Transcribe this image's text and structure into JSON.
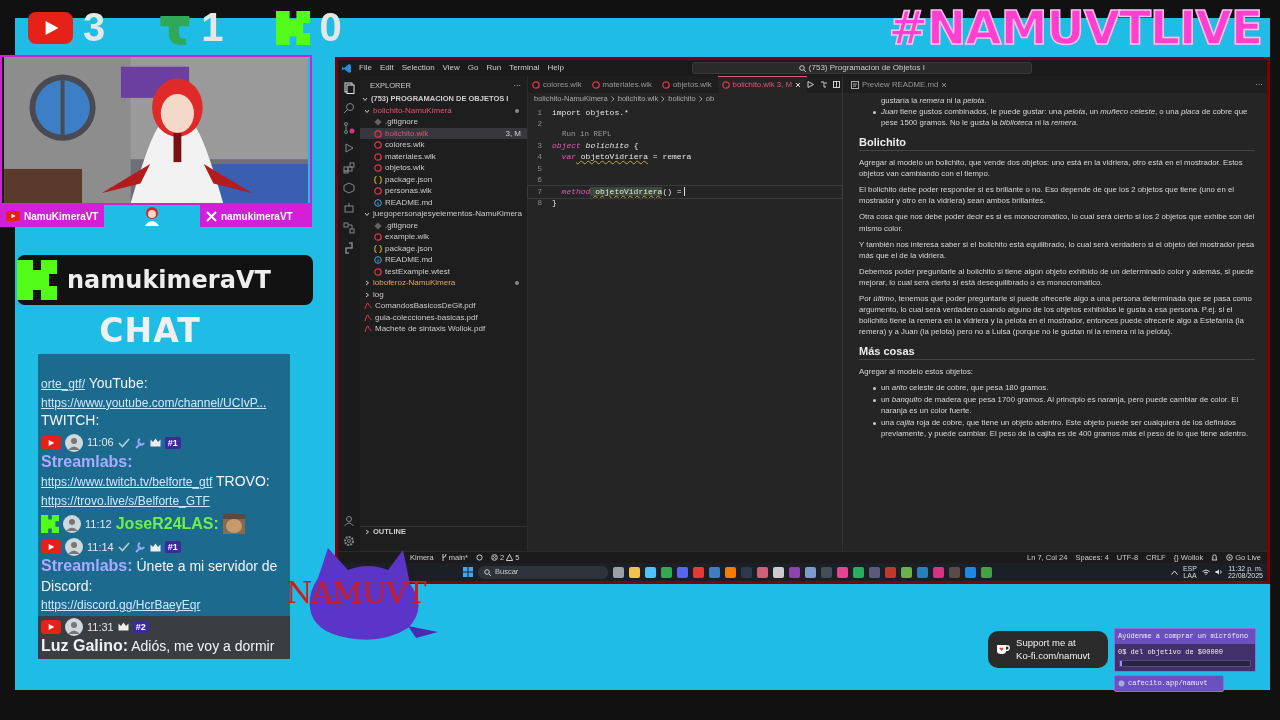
{
  "counters": [
    {
      "kind": "youtube",
      "count": "3"
    },
    {
      "kind": "trovo",
      "count": "1"
    },
    {
      "kind": "kick",
      "count": "0"
    }
  ],
  "hashtag": "#NAMUVTLIVE",
  "avatar_scene": {
    "kind": "picture"
  },
  "socials": {
    "left": {
      "kind": "youtube",
      "handle": "NamuKimeraVT"
    },
    "right": {
      "kind": "x",
      "handle": "namukimeraVT"
    }
  },
  "kick_channel": "namukimeraVT",
  "chat_title": "CHAT",
  "chat": [
    {
      "parts": [
        {
          "kind": "link",
          "text": "orte_gtf/"
        },
        {
          "kind": "text",
          "text": " YouTube:"
        },
        {
          "kind": "link",
          "text": "https://www.youtube.com/channel/UCIvP..."
        },
        {
          "kind": "text",
          "text": " TWITCH:"
        }
      ]
    },
    {
      "header": {
        "kind": "youtube",
        "time": "11:06",
        "verified": true,
        "badge": "#1"
      },
      "user": {
        "name": "Streamlabs:",
        "color": "#a9abff"
      },
      "parts": [
        {
          "kind": "link",
          "text": "https://www.twitch.tv/belforte_gtf"
        },
        {
          "kind": "text",
          "text": " TROVO:"
        },
        {
          "kind": "link",
          "text": "https://trovo.live/s/Belforte_GTF"
        }
      ]
    },
    {
      "header": {
        "kind": "kick",
        "time": "11:12",
        "verified": false
      },
      "user": {
        "name": "JoseR24LAS:",
        "color": "#6ef04a"
      },
      "emote": true
    },
    {
      "header": {
        "kind": "youtube",
        "time": "11:14",
        "verified": true,
        "badge": "#1"
      },
      "user": {
        "name": "Streamlabs:",
        "color": "#a9abff"
      },
      "parts": [
        {
          "kind": "text",
          "text": " Únete a mi servidor de Discord:"
        },
        {
          "kind": "link",
          "text": "https://discord.gg/HcrBaeyEqr"
        }
      ]
    },
    {
      "header": {
        "kind": "youtube",
        "time": "11:31",
        "verified": false,
        "badge": "#2"
      },
      "user": {
        "name": "Luz Galino:",
        "color": "#f2f2f2"
      },
      "parts": [
        {
          "kind": "text",
          "text": " Adiós, me voy a dormir"
        }
      ]
    }
  ],
  "logo_text": "NAMUVT",
  "vscode": {
    "menu": [
      "File",
      "Edit",
      "Selection",
      "View",
      "Go",
      "Run",
      "Terminal",
      "Help"
    ],
    "command_center": "(753) Programacion de Objetos I",
    "activity": [
      {
        "kind": "files",
        "selected": true
      },
      {
        "kind": "search",
        "selected": false
      },
      {
        "kind": "branch",
        "selected": false
      },
      {
        "kind": "run",
        "selected": false
      },
      {
        "kind": "blocks",
        "selected": false
      },
      {
        "kind": "cube",
        "selected": false
      },
      {
        "kind": "robot",
        "selected": false
      },
      {
        "kind": "nodes",
        "selected": false
      },
      {
        "kind": "logo",
        "selected": false
      }
    ],
    "explorer": {
      "title": "EXPLORER",
      "more": "···",
      "root": "(753) PROGRAMACION DE OBJETOS I",
      "outline": "OUTLINE",
      "tree": [
        {
          "label": "bolichito-NamuKimera",
          "kind": "folder",
          "expanded": true,
          "problems": true,
          "modified": true,
          "selected": false,
          "children": [
            {
              "label": ".gitignore",
              "kind": "git",
              "problems": false,
              "modified": false,
              "selected": false
            },
            {
              "label": "bolichito.wlk",
              "kind": "wollok",
              "problems": true,
              "modified": false,
              "badge": "3, M",
              "selected": true
            },
            {
              "label": "colores.wlk",
              "kind": "wollok",
              "problems": false,
              "modified": false,
              "selected": false
            },
            {
              "label": "materiales.wlk",
              "kind": "wollok",
              "problems": false,
              "modified": false,
              "selected": false
            },
            {
              "label": "objetos.wlk",
              "kind": "wollok",
              "problems": false,
              "modified": false,
              "selected": false
            },
            {
              "label": "package.json",
              "kind": "json",
              "problems": false,
              "modified": false,
              "selected": false
            },
            {
              "label": "personas.wlk",
              "kind": "wollok",
              "problems": false,
              "modified": false,
              "selected": false
            },
            {
              "label": "README.md",
              "kind": "info",
              "problems": false,
              "modified": false,
              "selected": false
            }
          ]
        },
        {
          "label": "juegopersonajesyelementos-NamuKimera",
          "kind": "folder",
          "expanded": true,
          "problems": false,
          "modified": false,
          "selected": false,
          "children": [
            {
              "label": ".gitignore",
              "kind": "git",
              "problems": false,
              "modified": false,
              "selected": false
            },
            {
              "label": "example.wlk",
              "kind": "wollok",
              "problems": false,
              "modified": false,
              "selected": false
            },
            {
              "label": "package.json",
              "kind": "json",
              "problems": false,
              "modified": false,
              "selected": false
            },
            {
              "label": "README.md",
              "kind": "info",
              "problems": false,
              "modified": false,
              "selected": false
            },
            {
              "label": "testExample.wtest",
              "kind": "wollok",
              "problems": false,
              "modified": false,
              "selected": false
            }
          ]
        },
        {
          "label": "loboferoz-NamuKimera",
          "kind": "folder",
          "expanded": false,
          "problems": false,
          "modified": true,
          "selected": false
        },
        {
          "label": "log",
          "kind": "folder",
          "expanded": false,
          "problems": false,
          "modified": false,
          "selected": false
        },
        {
          "label": "ComandosBasicosDeGit.pdf",
          "kind": "pdf",
          "problems": false,
          "modified": false,
          "selected": false
        },
        {
          "label": "guia-colecciones-basicas.pdf",
          "kind": "pdf",
          "problems": false,
          "modified": false,
          "selected": false
        },
        {
          "label": "Machete de sintaxis Wollok.pdf",
          "kind": "pdf",
          "problems": false,
          "modified": false,
          "selected": false
        }
      ]
    },
    "tabs": [
      {
        "label": "colores.wlk",
        "selected": false
      },
      {
        "label": "materiales.wlk",
        "selected": false
      },
      {
        "label": "objetos.wlk",
        "selected": false
      },
      {
        "label": "bolichito.wlk",
        "badge": "3, M",
        "selected": true
      }
    ],
    "breadcrumbs": [
      "bolichito-NamuKimera",
      "bolichito.wlk",
      "bolichito",
      "ob"
    ],
    "code": [
      {
        "kind": "line",
        "num": "1",
        "current": false,
        "tokens": [
          {
            "kind": "plain",
            "text": "import objetos.*"
          }
        ]
      },
      {
        "kind": "line",
        "num": "2",
        "current": false
      },
      {
        "kind": "codelens",
        "text": "Run in REPL"
      },
      {
        "kind": "line",
        "num": "3",
        "current": false,
        "tokens": [
          {
            "kind": "keyword",
            "text": "object"
          },
          {
            "kind": "name",
            "text": " bolichito"
          },
          {
            "kind": "plain",
            "text": " {"
          }
        ]
      },
      {
        "kind": "line",
        "num": "4",
        "current": false,
        "tokens": [
          {
            "kind": "keyword",
            "text": "  var"
          },
          {
            "kind": "warning",
            "text": " objetoVidriera"
          },
          {
            "kind": "plain",
            "text": " = remera"
          }
        ]
      },
      {
        "kind": "line",
        "num": "5",
        "current": false
      },
      {
        "kind": "line",
        "num": "6",
        "current": false
      },
      {
        "kind": "line",
        "num": "7",
        "current": true,
        "tokens": [
          {
            "kind": "keyword",
            "text": "  method"
          },
          {
            "kind": "match",
            "text": " objetoVidriera"
          },
          {
            "kind": "plain",
            "text": "() ="
          }
        ]
      },
      {
        "kind": "line",
        "num": "8",
        "current": false,
        "tokens": [
          {
            "kind": "plain",
            "text": "}"
          }
        ]
      }
    ],
    "preview": {
      "tab": "Preview README.md",
      "blocks": [
        {
          "kind": "cont",
          "text": "gustaría la *remera* ni la *pelota*."
        },
        {
          "kind": "bullet",
          "text": "*Juan* tiene gustos combinados, le puede gustar: una *pelota*, un *muñeco celeste*, o una *placa* de cobre que pese 1500 gramos. No le gusta la *biblioteca* ni la *remera*."
        },
        {
          "kind": "heading",
          "text": "Bolichito"
        },
        {
          "kind": "para",
          "text": "Agregar al modelo un bolichito, que vende dos objetos: uno está en la vidriera, otro está en el mostrador. Estos objetos van cambiando con el tiempo."
        },
        {
          "kind": "para",
          "text": "El bolichito debe poder responder si es brillante o no. Eso depende de que los 2 objetos que tiene (uno en el mostrador y otro en la vidriera) sean ambos brillantes."
        },
        {
          "kind": "para",
          "text": "Otra cosa que nos debe poder decir es si es monocromático, lo cual será cierto si los 2 objetos que exhibe son del mismo color."
        },
        {
          "kind": "para",
          "text": "Y también nos interesa saber si el bolichito está equilibrado, lo cual será verdadero si el objeto del mostrador pesa más que el de la vidriera."
        },
        {
          "kind": "para",
          "text": "Debemos poder preguntarle al bolichito si tiene algún objeto exhibido de un determinado color y además, si puede mejorar, lo cual será cierto si está desequilibrado o es monocromático."
        },
        {
          "kind": "para",
          "text": "Por *último*, tenemos que poder preguntarle si puede ofrecerle algo a una persona determinada que se pasa como argumento, lo cual será verdadero cuando alguno de los objetos exhibidos le gusta a esa persona. P.ej. si el bolichito tiene la remera en la vidriera y la pelota en el mostrador, entonces puede ofrecerle algo a Estefanía (la remera) y a Juan (la pelota) pero no a Luisa (porque no le gustan ni la remera ni la pelota)."
        },
        {
          "kind": "heading",
          "text": "Más cosas"
        },
        {
          "kind": "para",
          "text": "Agregar al modelo estos objetos:"
        },
        {
          "kind": "bullet",
          "text": "un *arito* celeste de cobre, que pesa 180 gramos."
        },
        {
          "kind": "bullet",
          "text": "un *banquito* de madera que pesa 1700 gramos. Al principio es naranja, pero puede cambiar de color. El naranja es un color fuerte."
        },
        {
          "kind": "bullet",
          "text": "una *cajita* roja de cobre, que tiene un objeto adentro. Este objeto puede ser cualquiera de los definidos previamente, y puede cambiar. El peso de la cajita es de 400 gramos más el peso de lo que tiene adentro."
        }
      ]
    },
    "status_left": {
      "project": "Kimera",
      "branch": "main*",
      "errors": "2",
      "warnings": "5"
    },
    "status_right": [
      "Ln 7, Col 24",
      "Spaces: 4",
      "UTF-8",
      "CRLF",
      "{} Wollok",
      "Go Live"
    ],
    "taskbar": {
      "search": "Buscar",
      "apps": [
        {
          "color": "#9aa0a6"
        },
        {
          "color": "#f2c14e"
        },
        {
          "color": "#4fc3f7"
        },
        {
          "color": "#34a853"
        },
        {
          "color": "#5865f2"
        },
        {
          "color": "#e53935"
        },
        {
          "color": "#3f7fbf"
        },
        {
          "color": "#f57c00"
        },
        {
          "color": "#2b3a4a"
        },
        {
          "color": "#d0607a"
        },
        {
          "color": "#cccccc"
        },
        {
          "color": "#8e44ad"
        },
        {
          "color": "#7a9cc6"
        },
        {
          "color": "#444c56"
        },
        {
          "color": "#e84393"
        },
        {
          "color": "#27ae60"
        },
        {
          "color": "#5c5c7a"
        },
        {
          "color": "#c0392b"
        },
        {
          "color": "#6ab04c"
        },
        {
          "color": "#2980b9"
        },
        {
          "color": "#d63384"
        },
        {
          "color": "#5a4a4a"
        },
        {
          "color": "#1e88e5"
        },
        {
          "color": "#43a047"
        }
      ],
      "lang": [
        "ESP",
        "LAA"
      ],
      "time": "11:32 p. m.",
      "date": "22/08/2025"
    }
  },
  "kofi": [
    "Support me at",
    "Ko-fi.com/namuvt"
  ],
  "goal": {
    "title": "Ayúdenme a comprar un micrófono",
    "amount": "0$ del objetivo de $00000",
    "level": 0,
    "link": "cafecito.app/namuvt"
  }
}
